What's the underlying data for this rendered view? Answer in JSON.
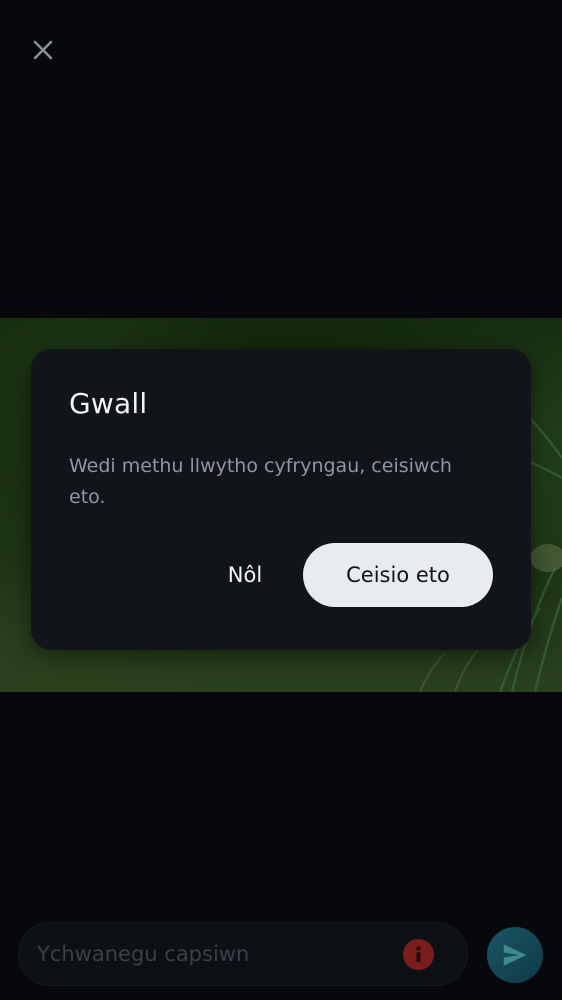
{
  "toolbar": {
    "close_icon": "close-icon"
  },
  "dialog": {
    "title": "Gwall",
    "message": "Wedi methu llwytho cyfryngau, ceisiwch eto.",
    "back_label": "Nôl",
    "retry_label": "Ceisio eto"
  },
  "composer": {
    "caption_placeholder": "Ychwanegu capsiwn",
    "caption_value": "",
    "info_icon": "info-icon",
    "send_icon": "send-icon"
  },
  "colors": {
    "background": "#06080b",
    "dialog_bg": "#111419",
    "retry_button_bg": "#e8ebf0",
    "error_icon": "#7b1d1d",
    "send_button": "#1a5566"
  }
}
